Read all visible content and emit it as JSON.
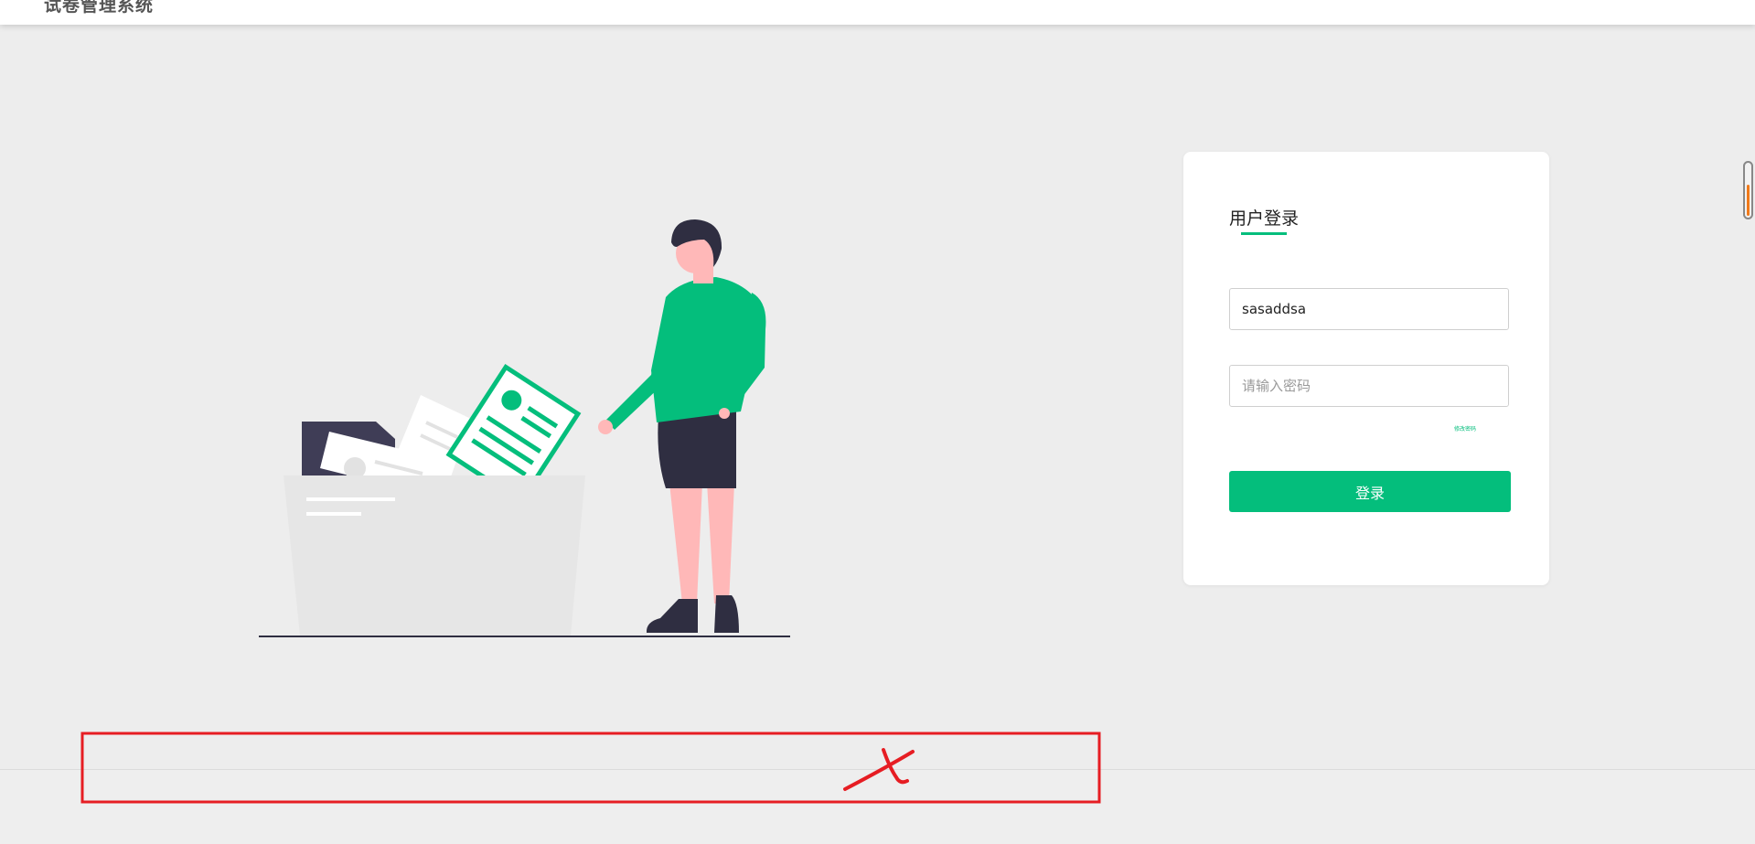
{
  "header": {
    "app_title": "试卷管理系统"
  },
  "login": {
    "title": "用户登录",
    "username_value": "sasaddsa",
    "password_placeholder": "请输入密码",
    "forgot_label": "修改密码",
    "submit_label": "登录"
  },
  "colors": {
    "accent": "#04be7c",
    "page_background": "#ededed",
    "card_background": "#ffffff",
    "annotation_red": "#e61d23",
    "scroll_indicator_fill": "#f07a1a"
  },
  "icons": {
    "annotation_mark": "cross-mark-icon"
  }
}
